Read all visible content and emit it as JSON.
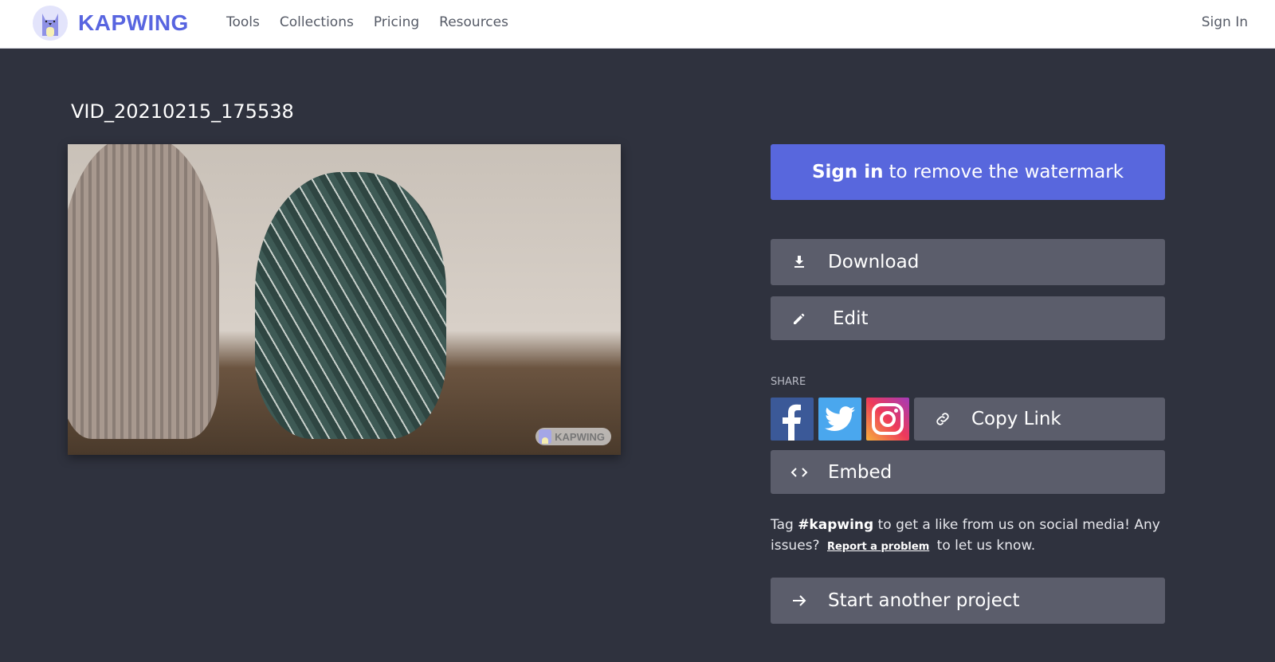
{
  "header": {
    "brand": "KAPWING",
    "nav": [
      "Tools",
      "Collections",
      "Pricing",
      "Resources"
    ],
    "sign_in": "Sign In"
  },
  "video": {
    "title": "VID_20210215_175538",
    "watermark": "KAPWING"
  },
  "panel": {
    "watermark_cta_bold": "Sign in",
    "watermark_cta_rest": "to remove the watermark",
    "download": "Download",
    "edit": "Edit",
    "share_label": "SHARE",
    "copy_link": "Copy Link",
    "embed": "Embed",
    "info_prefix": "Tag",
    "info_tag": "#kapwing",
    "info_middle": "to get a like from us on social media! Any issues?",
    "report_link": "Report a problem",
    "info_suffix": "to let us know.",
    "start_another": "Start another project"
  },
  "colors": {
    "brand": "#5865e0",
    "primary_button": "#5867dd",
    "background": "#2f323e",
    "secondary_button": "#5b5d6b"
  }
}
